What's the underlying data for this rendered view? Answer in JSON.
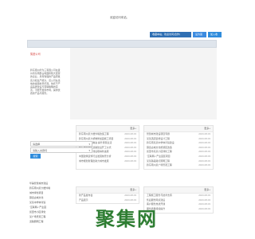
{
  "header": {
    "welcome": "欢迎访问本站。"
  },
  "topnav": {
    "items": [
      {
        "label": "收藏本站，欢迎访问(合作)"
      },
      {
        "label": "设为首页"
      },
      {
        "label": "加入收藏"
      }
    ]
  },
  "intro": {
    "title": "集团公司",
    "text": "黔东南州华为三有限公司在贵州省东南部占地面积较大经营的企业，具有较强的产品研发实力和生产能力，该公司在当地的发展前景乐观。依托于产品品牌建设与营销策略的完善，不断开发新市场，提供优质的产品与服务。"
  },
  "news_panel": {
    "more": "更多+",
    "rows": [
      {
        "title": "黔东南州某大楼外墙改造工程",
        "date": "2023-08-03"
      },
      {
        "title": "黔东南州某大桥维修加固施工项目",
        "date": "2023-08-03"
      },
      {
        "title": "小区改造全面推进 提升居民生活",
        "date": "2023-08-03"
      },
      {
        "title": "黔东南州某区道路建设开工仪式",
        "date": "2023-08-03"
      },
      {
        "title": "华美智慧城市建设取得新进展",
        "date": "2023-08-03"
      },
      {
        "title": "中国建筑装饰行业发展前景分析",
        "date": "2023-08-03"
      },
      {
        "title": "城市规划新理念助力城市发展",
        "date": "2023-08-03"
      }
    ]
  },
  "case_panel": {
    "more": "更多+",
    "rows": [
      {
        "title": "智慧城市建设项目专题",
        "date": "2023-08-03"
      },
      {
        "title": "某某酒店装修设计工程",
        "date": "2023-08-03"
      },
      {
        "title": "黔东南某某中学体育馆建设",
        "date": "2023-08-03"
      },
      {
        "title": "镇远古城文化旅游区改造",
        "date": "2023-08-03"
      },
      {
        "title": "凯里市某某小区绿化工程",
        "date": "2023-08-03"
      },
      {
        "title": "“互联网+”产业园区项目",
        "date": "2023-08-03"
      },
      {
        "title": "某某路段路灯照明工程",
        "date": "2023-08-03"
      },
      {
        "title": "黔东南州某广场景观工程",
        "date": "2023-08-03"
      }
    ]
  },
  "product_panel": {
    "more": "更多+",
    "rows": [
      {
        "title": "新产品发布会",
        "date": "2023-08-03"
      },
      {
        "title": "产品展示",
        "date": "2023-08-03"
      }
    ]
  },
  "service_panel": {
    "more": "更多+",
    "rows": [
      {
        "title": "工程施工服务与技术支持",
        "date": "2023-08-03"
      },
      {
        "title": "售后服务网点建设",
        "date": "2023-08-03"
      },
      {
        "title": "客户服务热线开通",
        "date": "2023-08-03"
      },
      {
        "title": "服务质量持续提升",
        "date": "2023-08-03"
      }
    ]
  },
  "sideform": {
    "select1": "请选择",
    "select2": "请输入关键词",
    "button": "搜索"
  },
  "left_list": {
    "items": [
      {
        "label": "华美智慧城市建设"
      },
      {
        "label": "黔东南州某大楼外墙"
      },
      {
        "label": "城市绿化项目"
      },
      {
        "label": "镇远古城文化"
      },
      {
        "label": "某某中学体育馆"
      },
      {
        "label": "“互联网+”产业园"
      },
      {
        "label": "凯里市小区绿化"
      },
      {
        "label": "某广场景观工程"
      },
      {
        "label": "道路照明工程"
      }
    ]
  },
  "watermark": {
    "text": "聚集网"
  },
  "colors": {
    "nav_dark": "#2f6fb3",
    "nav_light": "#3c8be0",
    "accent_red": "#d9534f",
    "watermark_green": "#2e7d32"
  }
}
